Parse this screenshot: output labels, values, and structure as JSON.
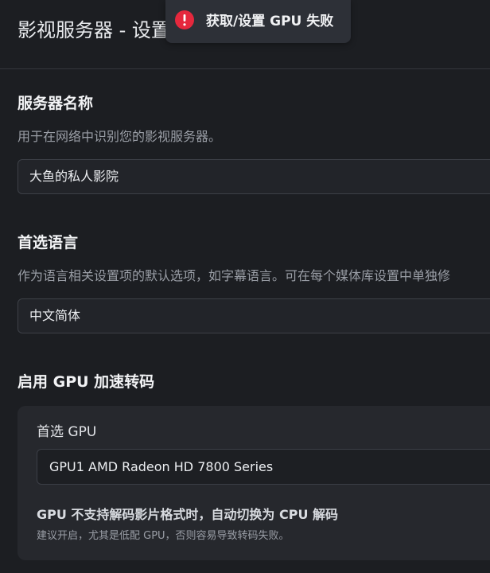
{
  "header": {
    "title": "影视服务器 - 设置"
  },
  "toast": {
    "icon": "alert-circle-icon",
    "message": "获取/设置 GPU 失败",
    "color": "#e5283d"
  },
  "server_name": {
    "title": "服务器名称",
    "description": "用于在网络中识别您的影视服务器。",
    "value": "大鱼的私人影院"
  },
  "language": {
    "title": "首选语言",
    "description": "作为语言相关设置项的默认选项，如字幕语言。可在每个媒体库设置中单独修",
    "value": "中文简体"
  },
  "gpu": {
    "title": "启用 GPU 加速转码",
    "preferred_label": "首选 GPU",
    "preferred_value": "GPU1 AMD Radeon HD 7800 Series",
    "fallback_title": "GPU 不支持解码影片格式时，自动切换为 CPU 解码",
    "fallback_desc": "建议开启，尤其是低配 GPU，否则容易导致转码失败。"
  }
}
